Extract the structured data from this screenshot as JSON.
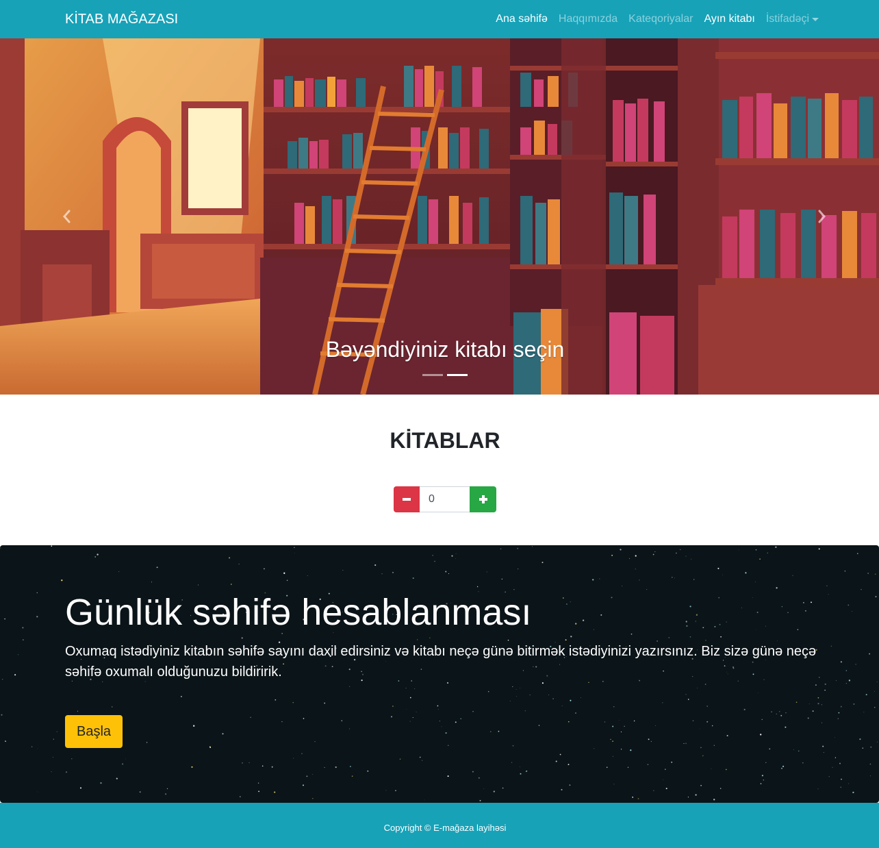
{
  "navbar": {
    "brand": "KİTAB MAĞAZASI",
    "links": [
      "Ana səhifə",
      "Haqqımızda",
      "Kateqoriyalar",
      "Ayın kitabı"
    ],
    "dropdown": "İstifadəçi"
  },
  "carousel": {
    "caption": "Bəyəndiyiniz kitabı seçin",
    "slide_count": 2,
    "active_slide": 2
  },
  "books": {
    "title": "KİTABLAR",
    "quantity": "0"
  },
  "jumbotron": {
    "title": "Günlük səhifə hesablanması",
    "text": "Oxumaq istədiyiniz kitabın səhifə sayını daxil edirsiniz və kitabı neçə günə bitirmək istədiyinizi yazırsınız. Biz sizə günə neçə səhifə oxumalı olduğunuzu bildiririk.",
    "button": "Başla"
  },
  "footer": {
    "copyright": "Copyright © E-mağaza layihəsi"
  },
  "colors": {
    "primary": "#17a2b8",
    "danger": "#dc3545",
    "success": "#28a745",
    "warning": "#ffc107"
  },
  "icons": {
    "prev": "chevron-left-icon",
    "next": "chevron-right-icon",
    "minus": "minus-icon",
    "plus": "plus-icon",
    "caret": "caret-down-icon"
  }
}
